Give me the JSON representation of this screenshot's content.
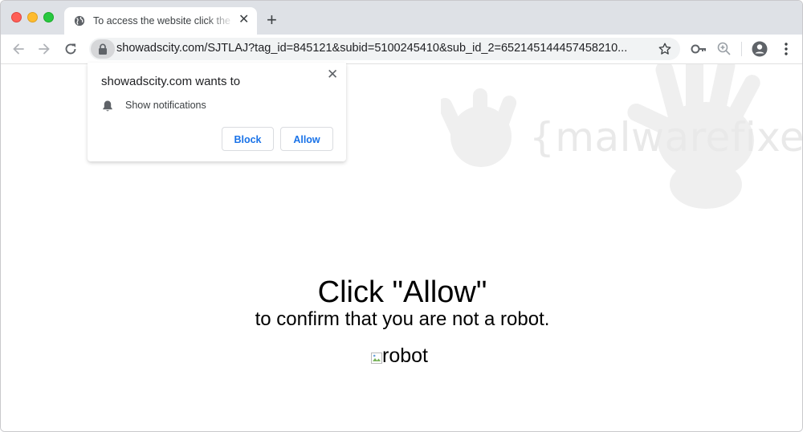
{
  "browser": {
    "traffic_lights": {
      "close": "#fe5f57",
      "minimize": "#febb2e",
      "zoom": "#28c840"
    },
    "tab": {
      "title": "To access the website click the",
      "icon": "globe-icon",
      "close_glyph": "✕"
    },
    "new_tab_glyph": "+",
    "address_bar": {
      "url": "showadscity.com/SJTLAJ?tag_id=845121&subid=5100245410&sub_id_2=652145144457458210...",
      "security_icon": "lock-icon"
    }
  },
  "notification_prompt": {
    "title": "showadscity.com wants to",
    "close_glyph": "✕",
    "permission": "Show notifications",
    "block_label": "Block",
    "allow_label": "Allow",
    "accent_color": "#1a73e8"
  },
  "page": {
    "watermark": "{malwarefixes}",
    "headline": "Click \"Allow\"",
    "subline": "to confirm that you are not a robot.",
    "image_alt": "robot"
  }
}
